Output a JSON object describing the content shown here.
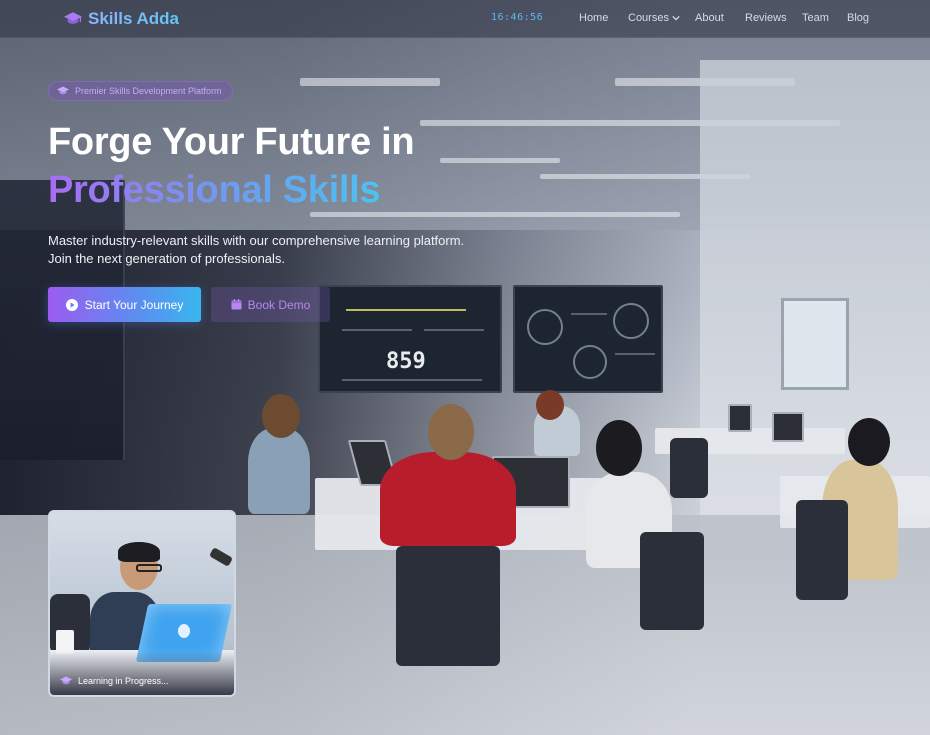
{
  "brand": {
    "name": "Skills Adda",
    "icon": "graduation-cap-icon",
    "color": "#6fb6f8"
  },
  "clock": "16:46:56",
  "nav": {
    "items": [
      {
        "label": "Home"
      },
      {
        "label": "Courses",
        "has_dropdown": true
      },
      {
        "label": "About"
      },
      {
        "label": "Reviews"
      },
      {
        "label": "Team"
      },
      {
        "label": "Blog"
      }
    ]
  },
  "hero": {
    "badge": "Premier Skills Development Platform",
    "title_line1": "Forge Your Future in",
    "title_line2": "Professional Skills",
    "subtitle_line1": "Master industry-relevant skills with our comprehensive learning platform.",
    "subtitle_line2": "Join the next generation of professionals.",
    "primary_cta": {
      "label": "Start Your Journey",
      "icon": "play-circle-icon"
    },
    "secondary_cta": {
      "label": "Book Demo",
      "icon": "calendar-icon"
    }
  },
  "card": {
    "label": "Learning in Progress...",
    "icon": "graduation-cap-icon"
  },
  "colors": {
    "accent_purple": "#9b5cf0",
    "accent_blue": "#39b7ee",
    "badge_text": "#c9a8ff"
  }
}
